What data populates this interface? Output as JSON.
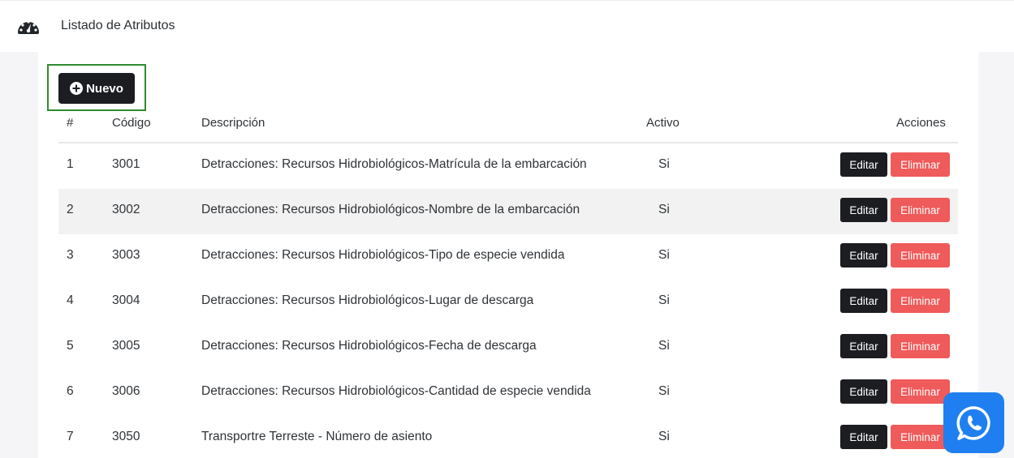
{
  "header": {
    "title": "Listado de Atributos",
    "icon": "tachometer-icon"
  },
  "toolbar": {
    "new_label": "Nuevo"
  },
  "table": {
    "columns": {
      "num": "#",
      "code": "Código",
      "description": "Descripción",
      "active": "Activo",
      "actions": "Acciones"
    },
    "edit_label": "Editar",
    "delete_label": "Eliminar",
    "rows": [
      {
        "num": "1",
        "code": "3001",
        "description": "Detracciones: Recursos Hidrobiológicos-Matrícula de la embarcación",
        "active": "Si"
      },
      {
        "num": "2",
        "code": "3002",
        "description": "Detracciones: Recursos Hidrobiológicos-Nombre de la embarcación",
        "active": "Si"
      },
      {
        "num": "3",
        "code": "3003",
        "description": "Detracciones: Recursos Hidrobiológicos-Tipo de especie vendida",
        "active": "Si"
      },
      {
        "num": "4",
        "code": "3004",
        "description": "Detracciones: Recursos Hidrobiológicos-Lugar de descarga",
        "active": "Si"
      },
      {
        "num": "5",
        "code": "3005",
        "description": "Detracciones: Recursos Hidrobiológicos-Fecha de descarga",
        "active": "Si"
      },
      {
        "num": "6",
        "code": "3006",
        "description": "Detracciones: Recursos Hidrobiológicos-Cantidad de especie vendida",
        "active": "Si"
      },
      {
        "num": "7",
        "code": "3050",
        "description": "Transportre Terreste - Número de asiento",
        "active": "Si"
      }
    ]
  },
  "colors": {
    "primary_dark": "#1c1d21",
    "danger": "#ef5a5a",
    "highlight": "#2e8b2e",
    "whatsapp_bg": "#1f7ff0"
  }
}
